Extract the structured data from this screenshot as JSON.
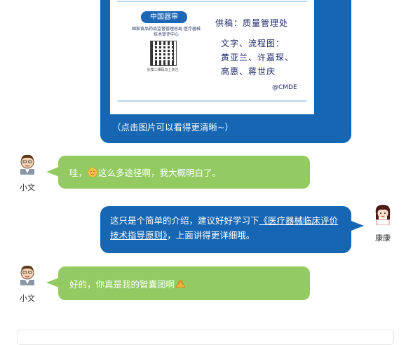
{
  "top_message": {
    "image": {
      "logo_text": "中国器审",
      "org_name": "国家食品药品监督管理总局 医疗器械技术审评中心",
      "qr_caption": "长按二维码马上关注",
      "supplier": "供稿：质量管理处",
      "credit_lines": [
        "文字、流程图：",
        "黄亚兰、许嘉琛、",
        "高惠、蒋世庆"
      ],
      "watermark": "@CMDE"
    },
    "caption": "（点击图片可以看得更清晰~）"
  },
  "messages": [
    {
      "sender": "小文",
      "side": "left",
      "text_before": "哇，",
      "emoji": "smiling-face-emoji",
      "text_after": "这么多途径啊，我大概明白了。"
    },
    {
      "sender": "康康",
      "side": "right",
      "text_before": "这只是个简单的介绍，建议好好学习下",
      "link": "《医疗器械临床评价技术指导原则》",
      "text_after": "，上面讲得更详细哦。"
    },
    {
      "sender": "小文",
      "side": "left",
      "text_before": "好的，你真是我的智囊团啊",
      "emoji": "applause-emoji",
      "text_after": ""
    }
  ],
  "colors": {
    "green_bubble": "#93cb62",
    "blue_bubble": "#1766b3"
  }
}
